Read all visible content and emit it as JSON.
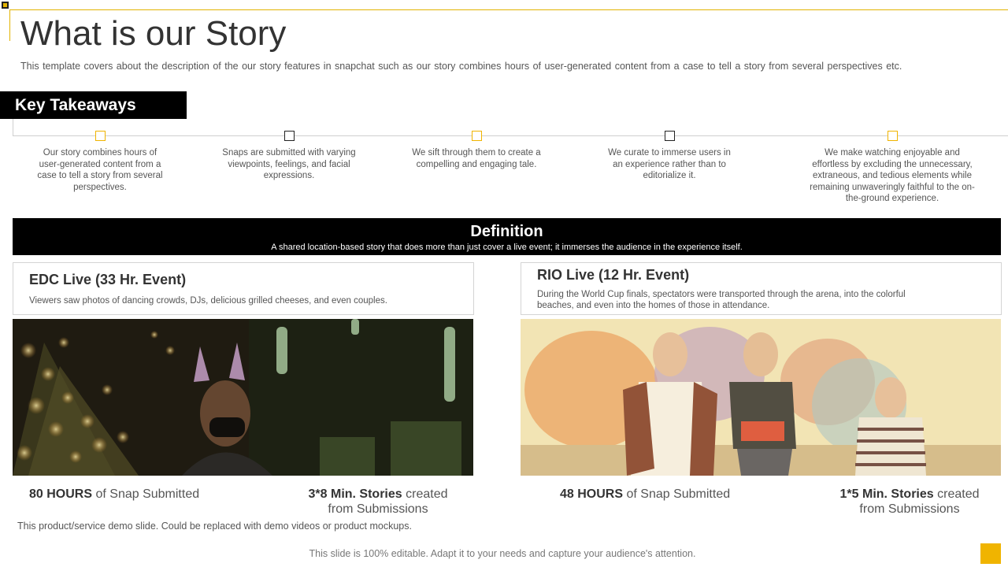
{
  "slide": {
    "title": "What is our Story",
    "subtitle": "This template covers about the description of the our story features in snapchat such as our story combines hours of user-generated  content from a case to tell a story from several perspectives  etc."
  },
  "key_takeaways": {
    "label": "Key Takeaways",
    "items": [
      {
        "text": "Our story combines hours of user-generated content from a case to tell a story from several perspectives.",
        "marker_color": "#f0b400"
      },
      {
        "text": "Snaps are submitted with varying viewpoints, feelings, and facial expressions.",
        "marker_color": "#222222"
      },
      {
        "text": "We sift through them to create a compelling and engaging tale.",
        "marker_color": "#f0b400"
      },
      {
        "text": "We curate to immerse users in an experience rather than to editorialize it.",
        "marker_color": "#222222"
      },
      {
        "text": "We make watching enjoyable and effortless by excluding the unnecessary, extraneous, and tedious elements while remaining unwaveringly faithful to the on-the-ground experience.",
        "marker_color": "#f0b400"
      }
    ]
  },
  "definition": {
    "title": "Definition",
    "text": "A shared location-based story that does more than just cover a live event; it immerses the audience in the experience itself."
  },
  "events": [
    {
      "title": "EDC Live (33 Hr. Event)",
      "description": "Viewers saw photos of dancing crowds, DJs, delicious grilled cheeses, and even couples.",
      "hours_value": "80 HOURS",
      "hours_text": " of Snap Submitted",
      "stories_value": "3*8 Min.  Stories",
      "stories_text_1": " created",
      "stories_text_2": "from Submissions"
    },
    {
      "title": "RIO Live (12 Hr. Event)",
      "description": "During the World Cup finals, spectators were transported through the arena, into the colorful beaches, and even into the homes of those in attendance.",
      "hours_value": "48 HOURS",
      "hours_text": " of Snap Submitted",
      "stories_value": "1*5 Min.  Stories",
      "stories_text_1": " created",
      "stories_text_2": "from Submissions"
    }
  ],
  "demo_note": "This product/service demo slide. Could be replaced with demo videos or product mockups.",
  "footer": "This slide is 100% editable. Adapt it to your needs and capture your audience's attention.",
  "colors": {
    "accent": "#f0b400",
    "dark": "#000000"
  }
}
